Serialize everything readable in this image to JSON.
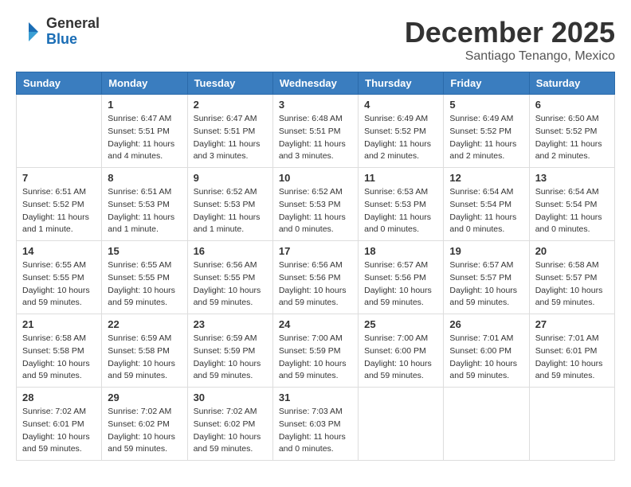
{
  "logo": {
    "general": "General",
    "blue": "Blue"
  },
  "title": "December 2025",
  "location": "Santiago Tenango, Mexico",
  "days_of_week": [
    "Sunday",
    "Monday",
    "Tuesday",
    "Wednesday",
    "Thursday",
    "Friday",
    "Saturday"
  ],
  "weeks": [
    [
      {
        "day": "",
        "info": ""
      },
      {
        "day": "1",
        "info": "Sunrise: 6:47 AM\nSunset: 5:51 PM\nDaylight: 11 hours\nand 4 minutes."
      },
      {
        "day": "2",
        "info": "Sunrise: 6:47 AM\nSunset: 5:51 PM\nDaylight: 11 hours\nand 3 minutes."
      },
      {
        "day": "3",
        "info": "Sunrise: 6:48 AM\nSunset: 5:51 PM\nDaylight: 11 hours\nand 3 minutes."
      },
      {
        "day": "4",
        "info": "Sunrise: 6:49 AM\nSunset: 5:52 PM\nDaylight: 11 hours\nand 2 minutes."
      },
      {
        "day": "5",
        "info": "Sunrise: 6:49 AM\nSunset: 5:52 PM\nDaylight: 11 hours\nand 2 minutes."
      },
      {
        "day": "6",
        "info": "Sunrise: 6:50 AM\nSunset: 5:52 PM\nDaylight: 11 hours\nand 2 minutes."
      }
    ],
    [
      {
        "day": "7",
        "info": "Sunrise: 6:51 AM\nSunset: 5:52 PM\nDaylight: 11 hours\nand 1 minute."
      },
      {
        "day": "8",
        "info": "Sunrise: 6:51 AM\nSunset: 5:53 PM\nDaylight: 11 hours\nand 1 minute."
      },
      {
        "day": "9",
        "info": "Sunrise: 6:52 AM\nSunset: 5:53 PM\nDaylight: 11 hours\nand 1 minute."
      },
      {
        "day": "10",
        "info": "Sunrise: 6:52 AM\nSunset: 5:53 PM\nDaylight: 11 hours\nand 0 minutes."
      },
      {
        "day": "11",
        "info": "Sunrise: 6:53 AM\nSunset: 5:53 PM\nDaylight: 11 hours\nand 0 minutes."
      },
      {
        "day": "12",
        "info": "Sunrise: 6:54 AM\nSunset: 5:54 PM\nDaylight: 11 hours\nand 0 minutes."
      },
      {
        "day": "13",
        "info": "Sunrise: 6:54 AM\nSunset: 5:54 PM\nDaylight: 11 hours\nand 0 minutes."
      }
    ],
    [
      {
        "day": "14",
        "info": "Sunrise: 6:55 AM\nSunset: 5:55 PM\nDaylight: 10 hours\nand 59 minutes."
      },
      {
        "day": "15",
        "info": "Sunrise: 6:55 AM\nSunset: 5:55 PM\nDaylight: 10 hours\nand 59 minutes."
      },
      {
        "day": "16",
        "info": "Sunrise: 6:56 AM\nSunset: 5:55 PM\nDaylight: 10 hours\nand 59 minutes."
      },
      {
        "day": "17",
        "info": "Sunrise: 6:56 AM\nSunset: 5:56 PM\nDaylight: 10 hours\nand 59 minutes."
      },
      {
        "day": "18",
        "info": "Sunrise: 6:57 AM\nSunset: 5:56 PM\nDaylight: 10 hours\nand 59 minutes."
      },
      {
        "day": "19",
        "info": "Sunrise: 6:57 AM\nSunset: 5:57 PM\nDaylight: 10 hours\nand 59 minutes."
      },
      {
        "day": "20",
        "info": "Sunrise: 6:58 AM\nSunset: 5:57 PM\nDaylight: 10 hours\nand 59 minutes."
      }
    ],
    [
      {
        "day": "21",
        "info": "Sunrise: 6:58 AM\nSunset: 5:58 PM\nDaylight: 10 hours\nand 59 minutes."
      },
      {
        "day": "22",
        "info": "Sunrise: 6:59 AM\nSunset: 5:58 PM\nDaylight: 10 hours\nand 59 minutes."
      },
      {
        "day": "23",
        "info": "Sunrise: 6:59 AM\nSunset: 5:59 PM\nDaylight: 10 hours\nand 59 minutes."
      },
      {
        "day": "24",
        "info": "Sunrise: 7:00 AM\nSunset: 5:59 PM\nDaylight: 10 hours\nand 59 minutes."
      },
      {
        "day": "25",
        "info": "Sunrise: 7:00 AM\nSunset: 6:00 PM\nDaylight: 10 hours\nand 59 minutes."
      },
      {
        "day": "26",
        "info": "Sunrise: 7:01 AM\nSunset: 6:00 PM\nDaylight: 10 hours\nand 59 minutes."
      },
      {
        "day": "27",
        "info": "Sunrise: 7:01 AM\nSunset: 6:01 PM\nDaylight: 10 hours\nand 59 minutes."
      }
    ],
    [
      {
        "day": "28",
        "info": "Sunrise: 7:02 AM\nSunset: 6:01 PM\nDaylight: 10 hours\nand 59 minutes."
      },
      {
        "day": "29",
        "info": "Sunrise: 7:02 AM\nSunset: 6:02 PM\nDaylight: 10 hours\nand 59 minutes."
      },
      {
        "day": "30",
        "info": "Sunrise: 7:02 AM\nSunset: 6:02 PM\nDaylight: 10 hours\nand 59 minutes."
      },
      {
        "day": "31",
        "info": "Sunrise: 7:03 AM\nSunset: 6:03 PM\nDaylight: 11 hours\nand 0 minutes."
      },
      {
        "day": "",
        "info": ""
      },
      {
        "day": "",
        "info": ""
      },
      {
        "day": "",
        "info": ""
      }
    ]
  ]
}
